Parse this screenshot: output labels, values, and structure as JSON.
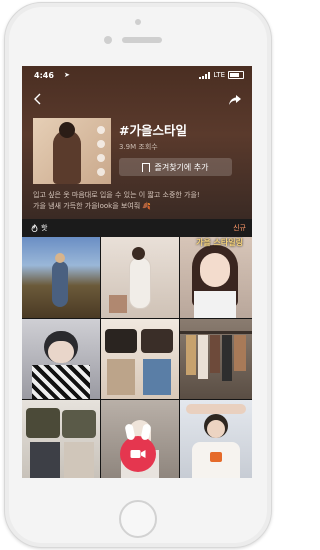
{
  "status_bar": {
    "time": "4:46",
    "network": "LTE"
  },
  "hashtag": {
    "title": "#가을스타일",
    "views": "3.9M 조회수",
    "favorite_label": "즐겨찾기에 추가"
  },
  "description": {
    "line1": "입고 싶은 옷 마음대로 입을 수 있는 이 짧고 소중한 가을!",
    "line2": "가을 냄새 가득한 가을look을 보여줘 🍂"
  },
  "tabs": {
    "hot": "핫",
    "new": "신규"
  },
  "overlay_texts": {
    "cell3": "가을 스타일링"
  },
  "grid_cells": [
    {
      "id": 1
    },
    {
      "id": 2
    },
    {
      "id": 3
    },
    {
      "id": 4
    },
    {
      "id": 5
    },
    {
      "id": 6
    },
    {
      "id": 7
    },
    {
      "id": 8
    },
    {
      "id": 9
    }
  ],
  "colors": {
    "accent": "#e5364f",
    "header_bg": "#4a2e22",
    "new_tab": "#ff9a6a"
  },
  "icons": [
    "back-icon",
    "share-icon",
    "bookmark-icon",
    "fire-icon",
    "camera-icon"
  ]
}
